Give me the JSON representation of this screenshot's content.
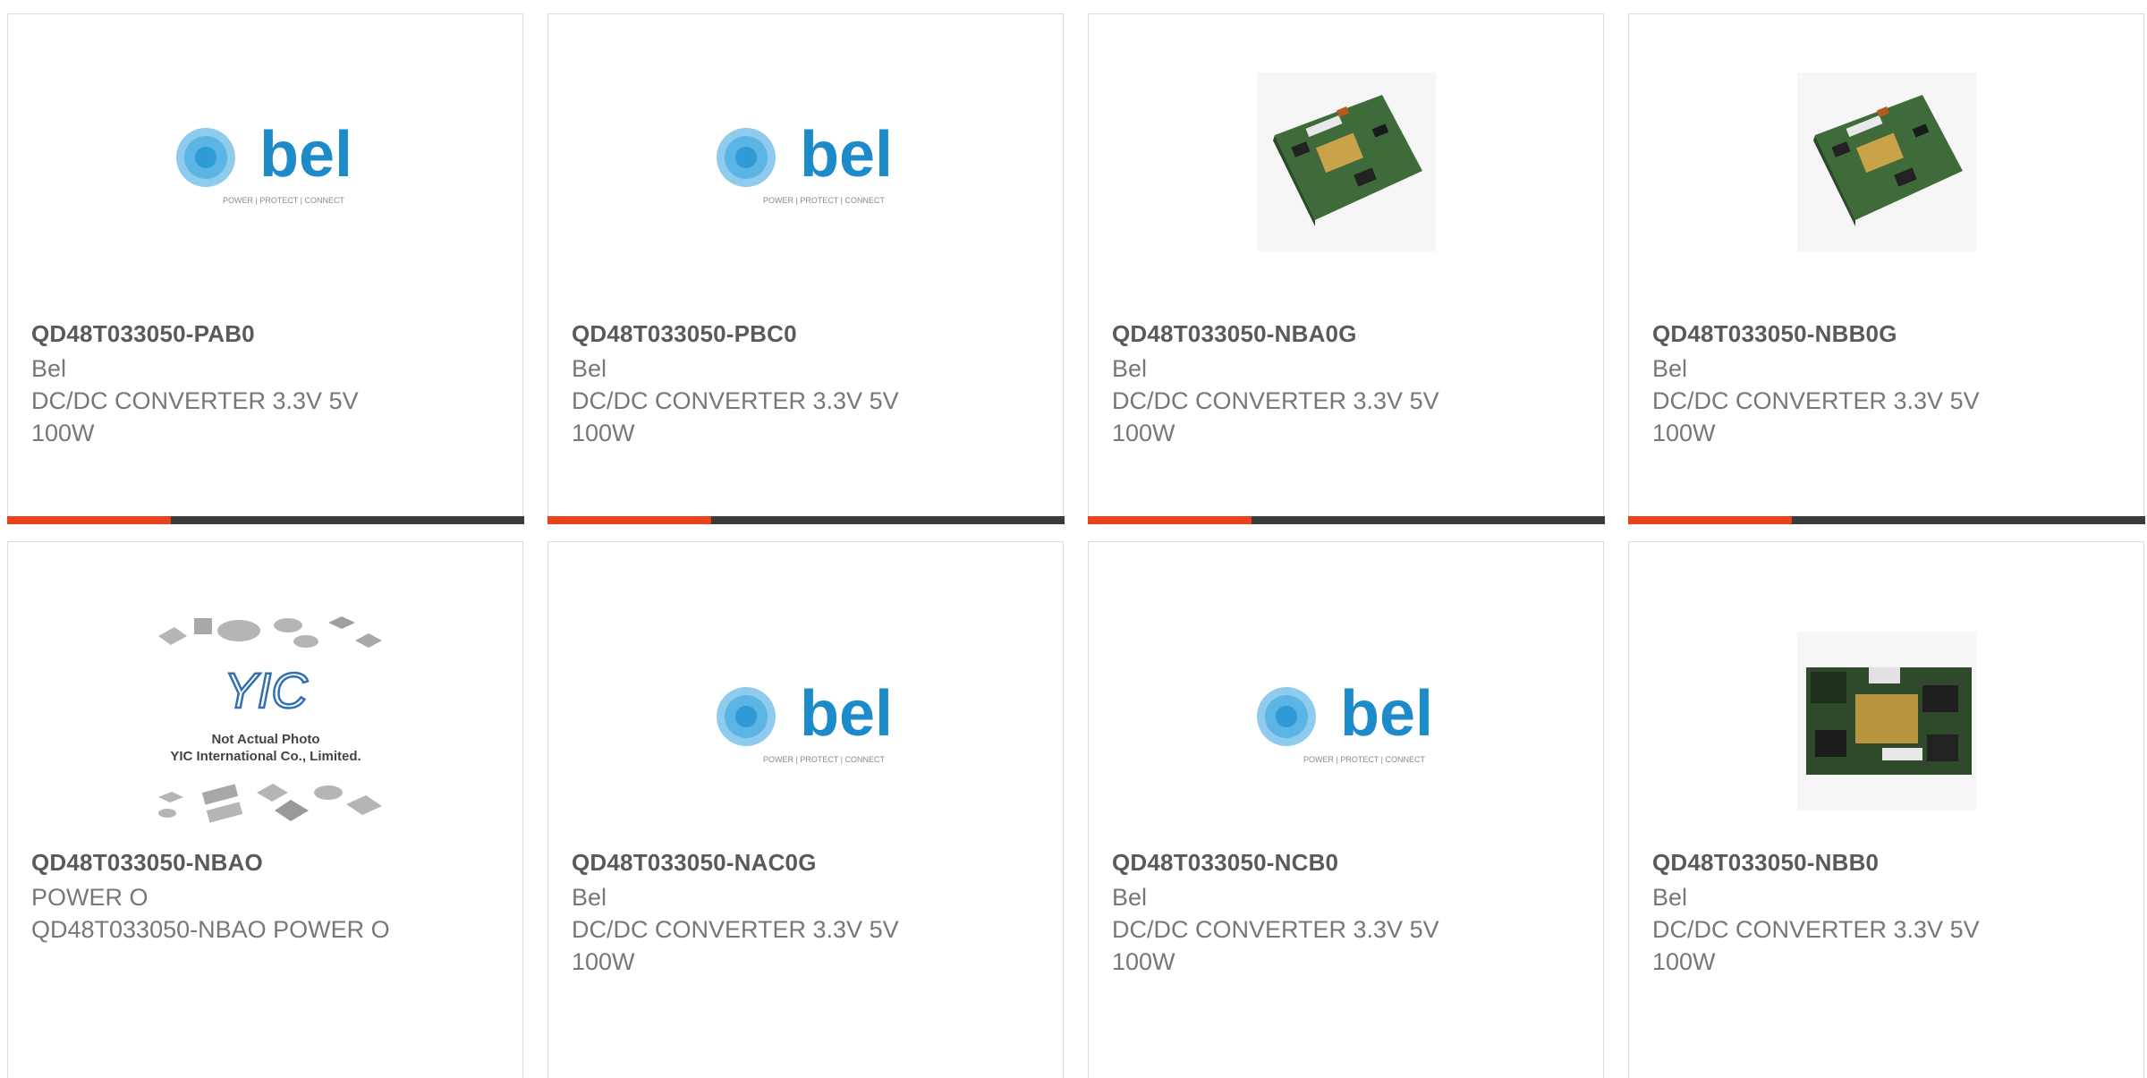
{
  "colors": {
    "accent": "#e8431c",
    "bar": "#3a3a3a",
    "bel_blue": "#1d8bc9"
  },
  "bel_logo": {
    "wordmark": "bel",
    "tagline": "POWER | PROTECT | CONNECT"
  },
  "placeholder": {
    "caption1": "Not Actual Photo",
    "caption2": "YIC International Co., Limited.",
    "mark": "YIC"
  },
  "products": [
    {
      "part": "QD48T033050-PAB0",
      "brand": "Bel",
      "desc1": "DC/DC CONVERTER 3.3V 5V",
      "desc2": "100W",
      "image": "bel-logo"
    },
    {
      "part": "QD48T033050-PBC0",
      "brand": "Bel",
      "desc1": "DC/DC CONVERTER 3.3V 5V",
      "desc2": "100W",
      "image": "bel-logo"
    },
    {
      "part": "QD48T033050-NBA0G",
      "brand": "Bel",
      "desc1": "DC/DC CONVERTER 3.3V 5V",
      "desc2": "100W",
      "image": "pcb-module"
    },
    {
      "part": "QD48T033050-NBB0G",
      "brand": "Bel",
      "desc1": "DC/DC CONVERTER 3.3V 5V",
      "desc2": "100W",
      "image": "pcb-module"
    },
    {
      "part": "QD48T033050-NBAO",
      "brand": "POWER O",
      "desc1": "QD48T033050-NBAO POWER O",
      "desc2": "",
      "image": "placeholder"
    },
    {
      "part": "QD48T033050-NAC0G",
      "brand": "Bel",
      "desc1": "DC/DC CONVERTER 3.3V 5V",
      "desc2": "100W",
      "image": "bel-logo"
    },
    {
      "part": "QD48T033050-NCB0",
      "brand": "Bel",
      "desc1": "DC/DC CONVERTER 3.3V 5V",
      "desc2": "100W",
      "image": "bel-logo"
    },
    {
      "part": "QD48T033050-NBB0",
      "brand": "Bel",
      "desc1": "DC/DC CONVERTER 3.3V 5V",
      "desc2": "100W",
      "image": "pcb-module-top"
    }
  ]
}
